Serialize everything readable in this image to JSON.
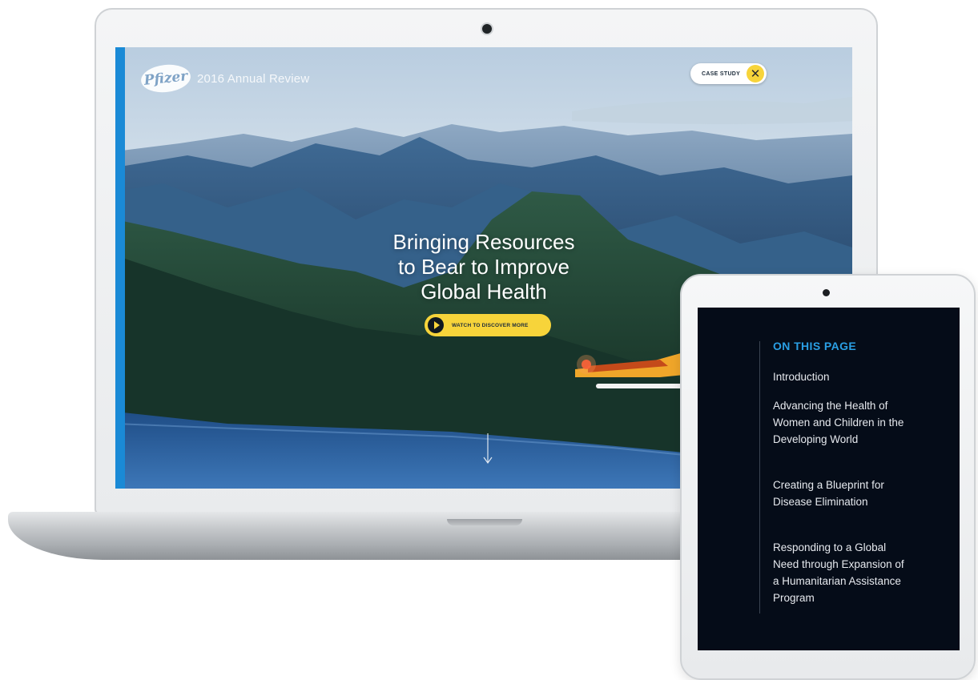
{
  "laptop": {
    "brand_logo": "Pfizer",
    "brand_title": "2016 Annual Review",
    "case_study_label": "CASE STUDY",
    "close_icon": "close-icon",
    "hero": {
      "line1": "Bringing Resources",
      "line2": "to Bear to Improve",
      "line3": "Global Health"
    },
    "watch_button_label": "WATCH TO DISCOVER MORE",
    "play_icon": "play-icon",
    "scroll_icon": "arrow-down-icon"
  },
  "tablet": {
    "heading": "ON THIS PAGE",
    "items": [
      {
        "label": "Introduction"
      },
      {
        "label": "Advancing the Health of Women and Children in the Developing World"
      },
      {
        "label": "Creating a Blueprint for Disease Elimination"
      },
      {
        "label": "Responding to a Global Need through Expansion of a Humanitarian Assistance Program"
      }
    ]
  },
  "colors": {
    "accent_blue": "#1a8ad6",
    "cta_yellow": "#f7d43a",
    "toc_heading": "#2a9fe4",
    "tablet_bg": "#050c18"
  }
}
